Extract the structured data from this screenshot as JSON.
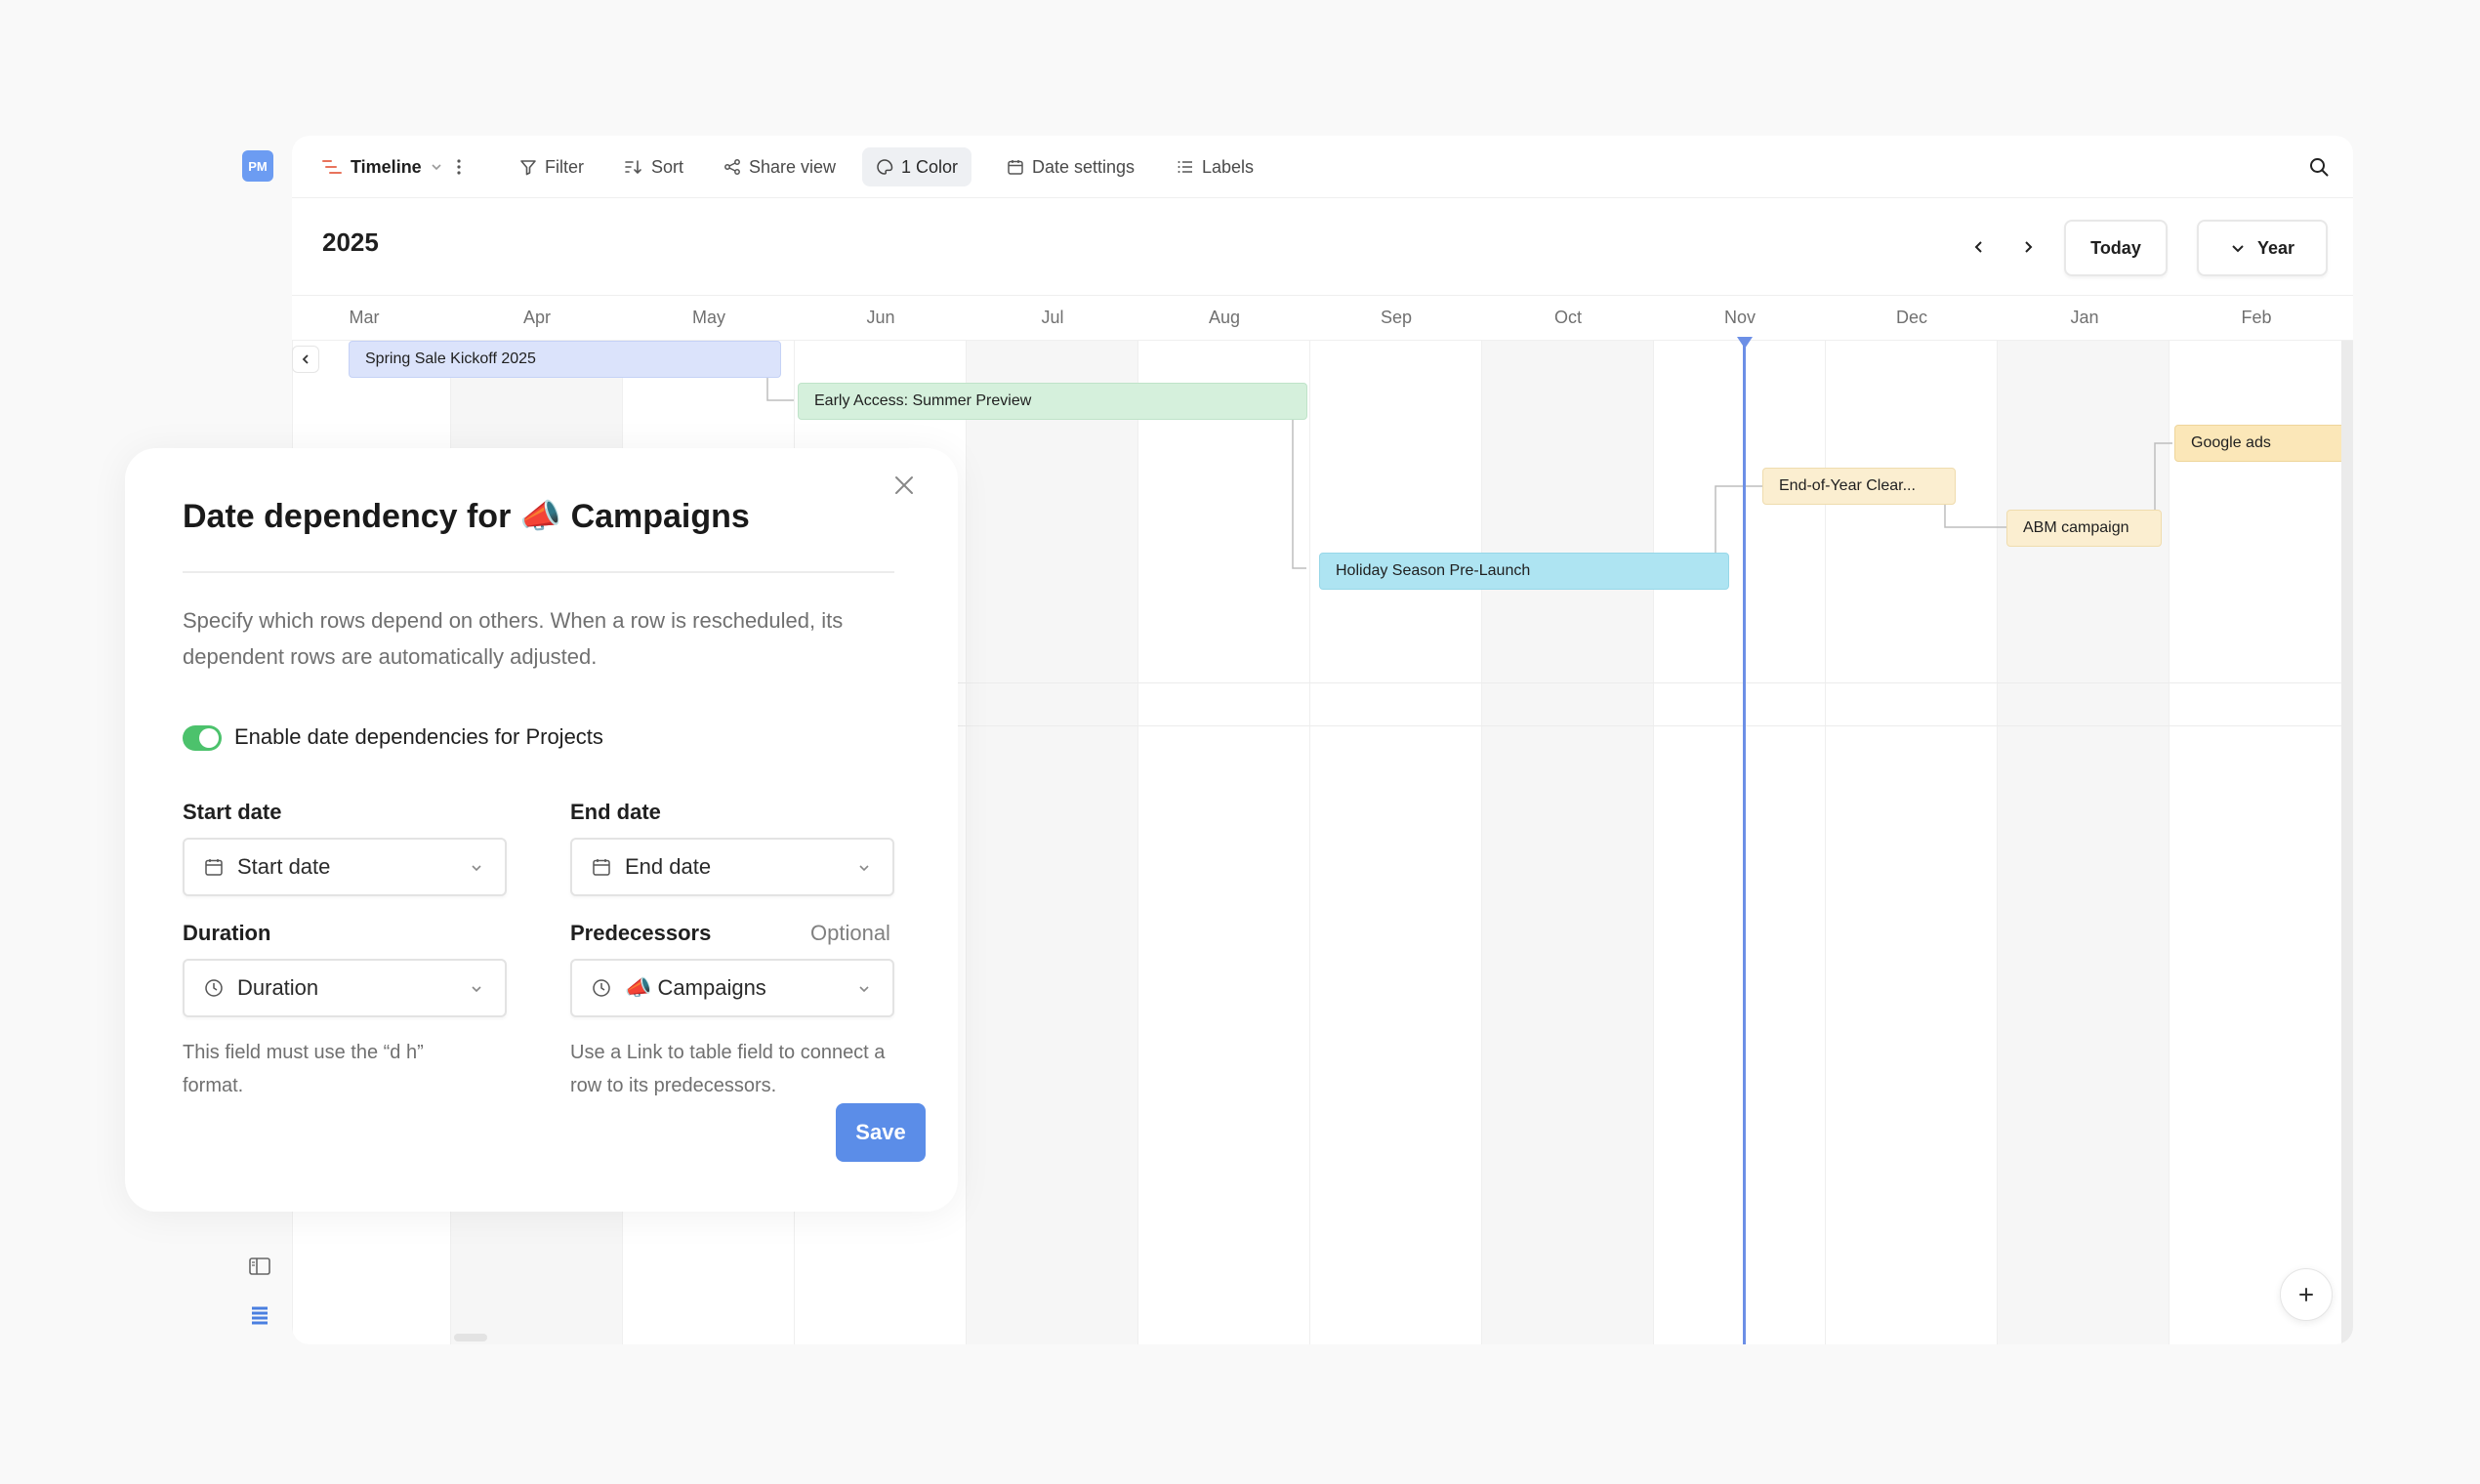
{
  "workspace": {
    "avatar_initials": "PM"
  },
  "toolbar": {
    "view_label": "Timeline",
    "filter_label": "Filter",
    "sort_label": "Sort",
    "share_label": "Share view",
    "color_label": "1 Color",
    "date_settings_label": "Date settings",
    "labels_label": "Labels"
  },
  "header": {
    "year": "2025",
    "today_label": "Today",
    "scale_label": "Year"
  },
  "months": [
    "Mar",
    "Apr",
    "May",
    "Jun",
    "Jul",
    "Aug",
    "Sep",
    "Oct",
    "Nov",
    "Dec",
    "Jan",
    "Feb"
  ],
  "bars": [
    {
      "label": "Spring Sale Kickoff 2025",
      "color": "#dbe3fb"
    },
    {
      "label": "Early Access: Summer Preview",
      "color": "#d5f0dc"
    },
    {
      "label": "Holiday Season Pre-Launch",
      "color": "#aee4f2"
    },
    {
      "label": "End-of-Year Clear...",
      "color": "#fbeed0"
    },
    {
      "label": "ABM campaign",
      "color": "#fbeed0"
    },
    {
      "label": "Google ads",
      "color": "#fbe7b8"
    }
  ],
  "today_color": "#6c8fe6",
  "modal": {
    "title_prefix": "Date dependency for",
    "title_emoji": "📣",
    "title_table": "Campaigns",
    "description": "Specify which rows depend on others. When a row is rescheduled, its dependent rows are automatically adjusted.",
    "toggle_label": "Enable date dependencies for Projects",
    "toggle_on": true,
    "start_label": "Start date",
    "start_value": "Start date",
    "end_label": "End date",
    "end_value": "End date",
    "duration_label": "Duration",
    "duration_value": "Duration",
    "duration_hint": "This field must use the “d h” format.",
    "pred_label": "Predecessors",
    "pred_optional": "Optional",
    "pred_emoji": "📣",
    "pred_value": "Campaigns",
    "pred_hint": "Use a Link to table field to connect a row to its predecessors.",
    "save_label": "Save"
  }
}
